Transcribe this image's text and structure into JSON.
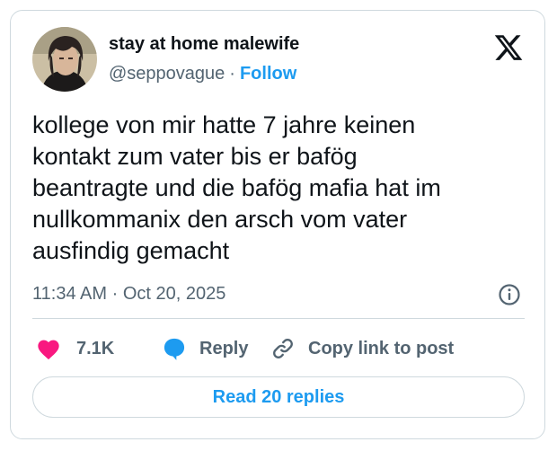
{
  "author": {
    "display_name": "stay at home malewife",
    "handle": "@seppovague",
    "separator": "·",
    "follow_label": "Follow"
  },
  "tweet": {
    "text": "kollege von mir hatte 7 jahre keinen\nkontakt zum vater bis er bafög\nbeantragte und die bafög mafia hat im\nnullkommanix den arsch vom vater\nausfindig gemacht",
    "time": "11:34 AM",
    "date_separator": "·",
    "date": "Oct 20, 2025"
  },
  "actions": {
    "like_count": "7.1K",
    "reply_label": "Reply",
    "copy_link_label": "Copy link to post"
  },
  "read_replies_label": "Read 20 replies",
  "icons": {
    "logo": "x-logo-icon",
    "info": "info-icon",
    "like": "heart-icon",
    "reply": "speech-bubble-icon",
    "copy": "link-icon"
  },
  "colors": {
    "accent": "#1d9bf0",
    "like": "#f91880",
    "text_secondary": "#536471",
    "border": "#cfd9de"
  }
}
